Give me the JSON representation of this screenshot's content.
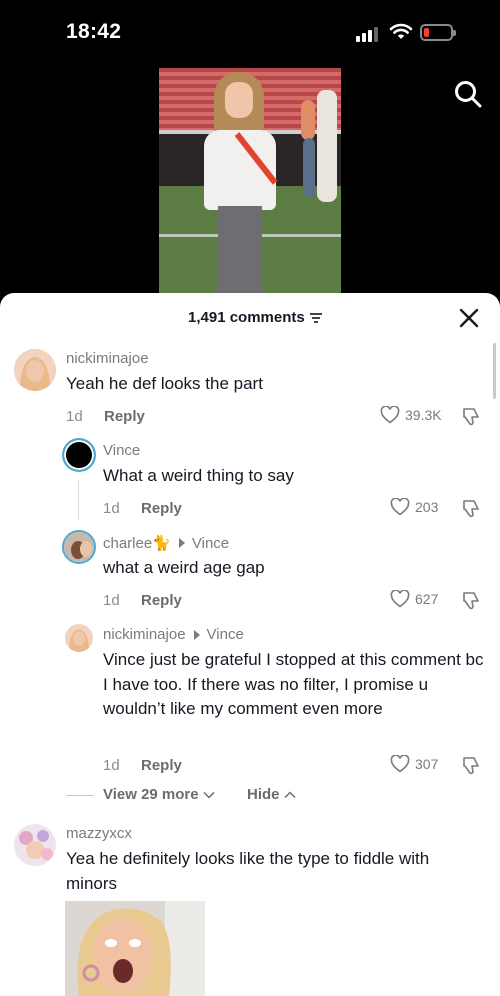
{
  "status_bar": {
    "time": "18:42"
  },
  "header": {
    "comment_count": "1,491 comments"
  },
  "comments": [
    {
      "username": "nickiminajoe",
      "text": "Yeah he def looks the part",
      "age": "1d",
      "reply_label": "Reply",
      "likes": "39.3K"
    },
    {
      "username": "Vince",
      "text": "What a weird thing to say",
      "age": "1d",
      "reply_label": "Reply",
      "likes": "203"
    },
    {
      "username": "charlee🐈",
      "reply_to": "Vince",
      "text": "what a weird age gap",
      "age": "1d",
      "reply_label": "Reply",
      "likes": "627"
    },
    {
      "username": "nickiminajoe",
      "reply_to": "Vince",
      "text": "Vince just be grateful I stopped at this comment bc I have too. If there was no filter, I promise u wouldn’t like my comment even more",
      "age": "1d",
      "reply_label": "Reply",
      "likes": "307"
    },
    {
      "username": "mazzyxcx",
      "text": "Yea he definitely looks like the type to fiddle with minors"
    }
  ],
  "thread_controls": {
    "view_more": "View 29 more",
    "hide": "Hide"
  },
  "colors": {
    "accent_red": "#ff3b30",
    "text_primary": "#161823",
    "text_secondary": "#7a7b80"
  },
  "icons": [
    "search-icon",
    "close-icon",
    "filter-icon",
    "heart-icon",
    "dislike-icon",
    "chevron-down-icon",
    "chevron-up-icon"
  ]
}
